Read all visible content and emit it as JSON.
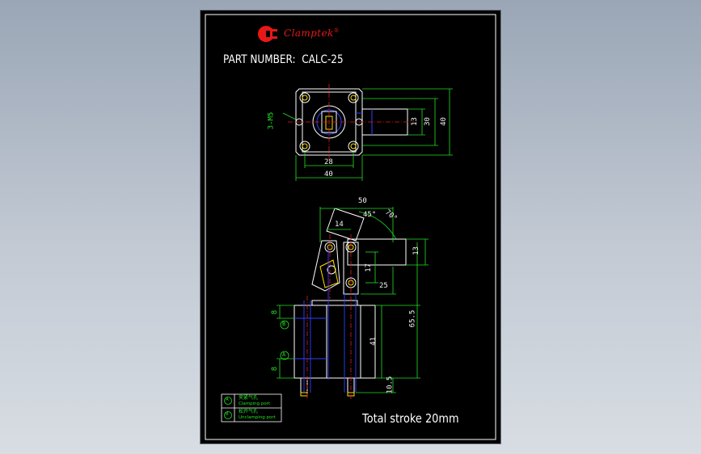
{
  "title_block": {
    "brand": "Clamptek",
    "registered_mark": "®",
    "part_number_label": "PART NUMBER:",
    "part_number": "CALC-25",
    "note": "Total stroke 20mm"
  },
  "top_view_dims": {
    "thread": "3-M5",
    "bore_spacing": "28",
    "width": "40",
    "arm_height": "13",
    "inner_height": "30",
    "outer_height": "40"
  },
  "side_view_dims": {
    "overall_length": "50",
    "swing_angle_1": "45°",
    "swing_angle_2": "70°",
    "pin_offset": "14",
    "arm_thickness": "13",
    "link_height": "17",
    "pivot_to_arm": "25",
    "total_height": "65.5",
    "body_height": "41",
    "port_offset_top": "8",
    "port_offset_bottom": "8",
    "base_step": "10.5"
  },
  "port_markers": {
    "a": "A",
    "b": "B"
  },
  "legend": [
    {
      "symbol": "A",
      "label_cn": "夹紧气孔",
      "label_en": "Clamping port"
    },
    {
      "symbol": "B",
      "label_cn": "松开气孔",
      "label_en": "Unclamping port"
    }
  ],
  "colors": {
    "sheet": "#000000",
    "outline": "#ffffff",
    "dimension": "#22e222",
    "hidden": "#3040ff",
    "centerline": "#e81818",
    "pivot": "#ffe000"
  }
}
